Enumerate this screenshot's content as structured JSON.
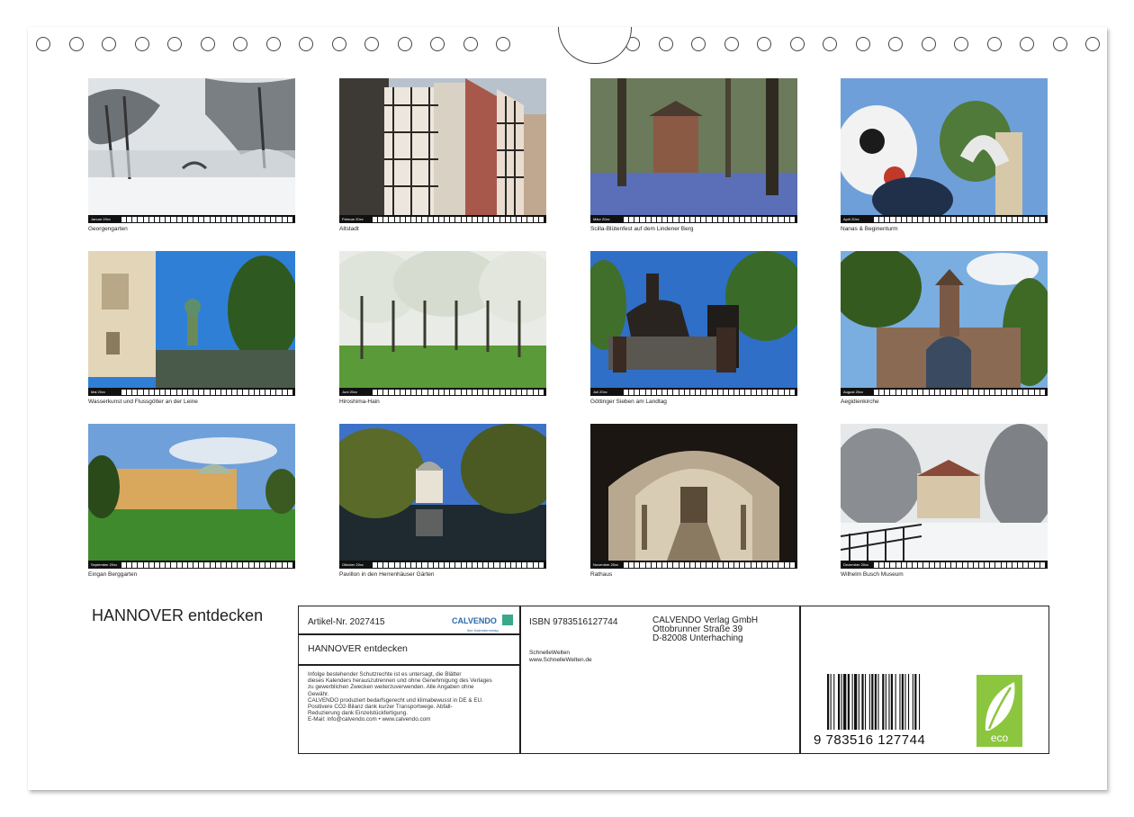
{
  "months": [
    {
      "label": "Januar 20xx",
      "caption": "Georgengarten"
    },
    {
      "label": "Februar 20xx",
      "caption": "Altstadt"
    },
    {
      "label": "März 20xx",
      "caption": "Scilla-Blütenfest auf dem Lindener Berg"
    },
    {
      "label": "April 20xx",
      "caption": "Nanas & Beginenturm"
    },
    {
      "label": "Mai 20xx",
      "caption": "Wasserkunst und Flussgötter an der Leine"
    },
    {
      "label": "Juni 20xx",
      "caption": "Hiroshima-Hain"
    },
    {
      "label": "Juli 20xx",
      "caption": "Göttinger Sieben am Landtag"
    },
    {
      "label": "August 20xx",
      "caption": "Aegidienkirche"
    },
    {
      "label": "September 20xx",
      "caption": "Eingan Berggarten"
    },
    {
      "label": "Oktober 20xx",
      "caption": "Pavillon in den Herrenhäuser Gärten"
    },
    {
      "label": "November 20xx",
      "caption": "Rathaus"
    },
    {
      "label": "Dezember 20xx",
      "caption": "Wilhelm Busch Museum"
    }
  ],
  "footer": {
    "title": "HANNOVER entdecken",
    "article": "Artikel-Nr. 2027415",
    "brand": "CALVENDO",
    "brand_sub": "Ihre Kalenderverlag",
    "product_title": "HANNOVER entdecken",
    "isbn": "ISBN 9783516127744",
    "author": "SchnelleWelten",
    "author_url": "www.SchnelleWelten.de",
    "publisher": [
      "CALVENDO Verlag GmbH",
      "Ottobrunner Straße 39",
      "D-82008 Unterhaching"
    ],
    "legal": [
      "Infolge bestehender Schutzrechte ist es untersagt, die Blätter",
      "dieses Kalenders herauszutrennen und ohne Genehmigung des Verlages",
      "zu gewerblichen Zwecken weiterzuverwenden. Alle Angaben ohne",
      "Gewähr.",
      "CALVENDO produziert bedarfsgerecht und klimabewusst in DE & EU.",
      "Positivere CO2-Bilanz dank kurzer Transportwege. Abfall-",
      "Reduzierung dank Einzelstückfertigung.",
      "E-Mail: info@calvendo.com • www.calvendo.com"
    ],
    "barcode_digits": "9 783516 127744",
    "eco_label": "eco"
  }
}
